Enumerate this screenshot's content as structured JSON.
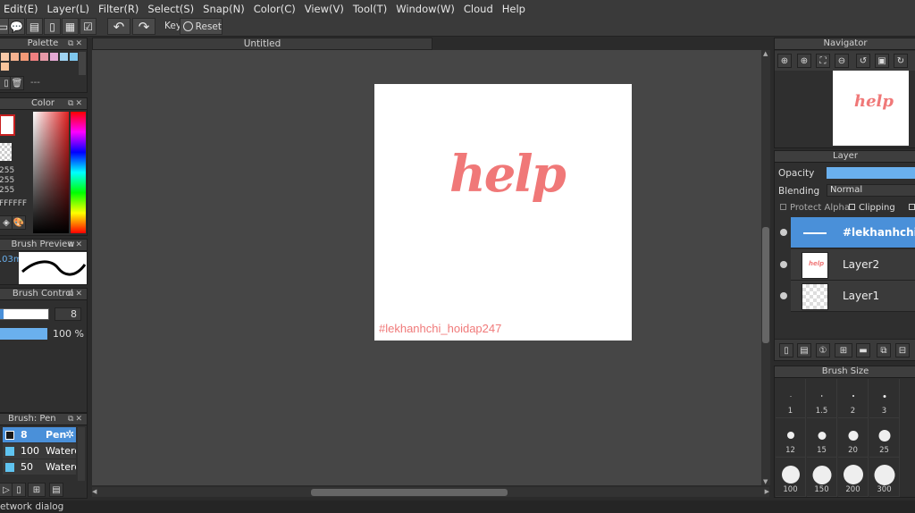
{
  "menu": [
    "Edit(E)",
    "Layer(L)",
    "Filter(R)",
    "Select(S)",
    "Snap(N)",
    "Color(C)",
    "View(V)",
    "Tool(T)",
    "Window(W)",
    "Cloud",
    "Help"
  ],
  "toolbar": {
    "key_label": "Key",
    "reset_label": "Reset"
  },
  "palette": {
    "title": "Palette",
    "dashes": "---",
    "colors": [
      "#f9c9a8",
      "#f6b28f",
      "#f49a77",
      "#f08080",
      "#e89aa8",
      "#e4a9d4",
      "#9fd3f2",
      "#7ec7ee",
      "#f8c49c"
    ]
  },
  "color_panel": {
    "title": "Color",
    "r": "255",
    "g": "255",
    "b": "255",
    "hex": "FFFFFF",
    "current": "#ffffff",
    "accent": "#c82020"
  },
  "brush_preview": {
    "title": "Brush Preview",
    "size_text": ".03m"
  },
  "brush_control": {
    "title": "Brush Control",
    "size_value": "8",
    "opacity_value": "100 %"
  },
  "brush_list": {
    "title": "Brush: Pen",
    "items": [
      {
        "size": "8",
        "name": "Pen",
        "color": "#1a1a1a"
      },
      {
        "size": "100",
        "name": "Watercolor",
        "color": "#5fc3ef"
      },
      {
        "size": "50",
        "name": "Watercolor",
        "color": "#5fc3ef"
      }
    ]
  },
  "document": {
    "tab_title": "Untitled",
    "art_word": "help",
    "hashtag": "#lekhanhchi_hoidap247"
  },
  "navigator": {
    "title": "Navigator"
  },
  "layer_panel": {
    "title": "Layer",
    "opacity_label": "Opacity",
    "blending_label": "Blending",
    "blending_value": "Normal",
    "protect_alpha": "Protect Alpha",
    "clipping": "Clipping",
    "layers": [
      {
        "name": "#lekhanhchi_",
        "selected": true
      },
      {
        "name": "Layer2",
        "selected": false
      },
      {
        "name": "Layer1",
        "selected": false
      }
    ]
  },
  "brush_size": {
    "title": "Brush Size",
    "sizes": [
      "1",
      "1.5",
      "2",
      "3",
      "12",
      "15",
      "20",
      "25",
      "100",
      "150",
      "200",
      "300"
    ]
  },
  "status": {
    "text": "etwork dialog"
  }
}
